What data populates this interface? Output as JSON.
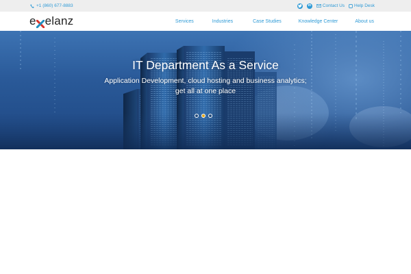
{
  "topbar": {
    "phone": "+1 (860) 677-8883",
    "twitter_icon": "twitter-icon",
    "linkedin_icon": "linkedin-icon",
    "contact": "Contact Us",
    "helpdesk": "Help Desk"
  },
  "logo": {
    "text_before": "e",
    "text_after": "elanz",
    "mark_icon": "x-mark-icon"
  },
  "nav": {
    "items": [
      {
        "label": "Services"
      },
      {
        "label": "Industries"
      },
      {
        "label": "Case Studies"
      },
      {
        "label": "Knowledge Center"
      },
      {
        "label": "About us"
      }
    ]
  },
  "hero": {
    "title": "IT Department As a Service",
    "subtitle_line1": "Application Development, cloud hosting and business analytics;",
    "subtitle_line2": "get all at one place",
    "slides": 3,
    "active_slide": 2
  },
  "colors": {
    "accent": "#2e9ad6",
    "topbar_bg": "#eeeeee",
    "active_dot": "#e0a51a",
    "logo_red": "#d9342b",
    "logo_teal": "#1f8fc0"
  }
}
